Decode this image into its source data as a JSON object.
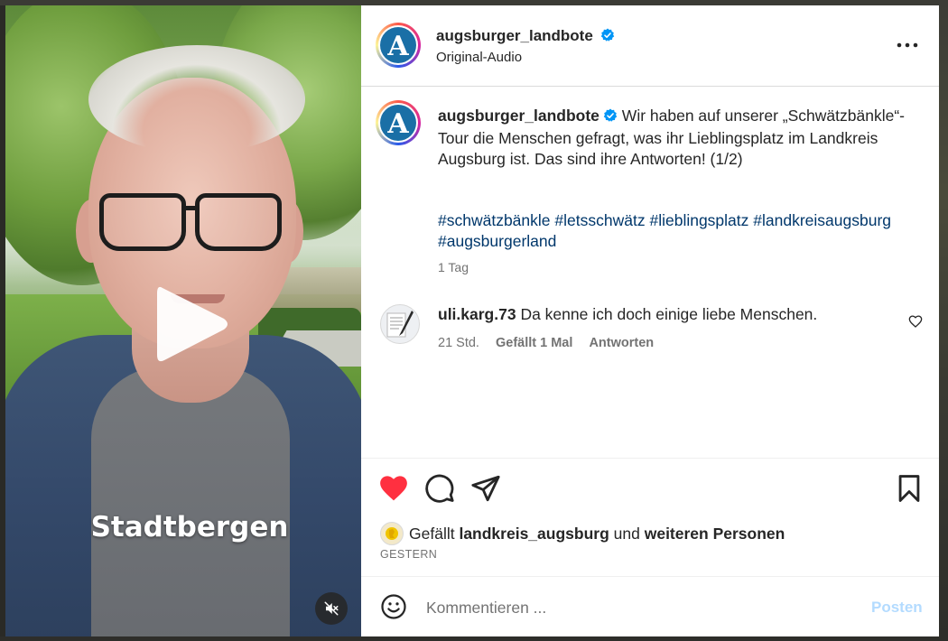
{
  "post": {
    "author": "augsburger_landbote",
    "audio": "Original-Audio",
    "caption": "Wir haben auf unserer „Schwätzbänkle“-Tour die Menschen gefragt, was ihr Lieblingsplatz im Landkreis Augsburg ist. Das sind ihre Antworten! (1/2)",
    "hashtags": [
      "#schwätzbänkle",
      "#letsschwätz",
      "#lieblingsplatz",
      "#landkreisaugsburg",
      "#augsburgerland"
    ],
    "age": "1 Tag",
    "video_caption": "Stadtbergen",
    "avatar_letter": "A"
  },
  "comment": {
    "user": "uli.karg.73",
    "text": "Da kenne ich doch einige liebe Menschen.",
    "time": "21 Std.",
    "likes": "Gefällt 1 Mal",
    "reply": "Antworten"
  },
  "likes": {
    "prefix": "Gefällt",
    "user": "landkreis_augsburg",
    "and": "und",
    "others": "weiteren Personen"
  },
  "date": "GESTERN",
  "composer": {
    "placeholder": "Kommentieren ...",
    "post_label": "Posten"
  },
  "icons": {
    "verified": "verified-badge-icon",
    "more": "more-options-icon",
    "like": "heart-filled-icon",
    "comment": "comment-bubble-icon",
    "share": "paper-plane-icon",
    "save": "bookmark-icon",
    "emoji": "smiley-icon",
    "mute": "speaker-muted-icon",
    "play": "play-icon"
  },
  "colors": {
    "like": "#ff3040",
    "link": "#00376b",
    "verified": "#0095f6",
    "post_disabled": "#b3dbff"
  }
}
